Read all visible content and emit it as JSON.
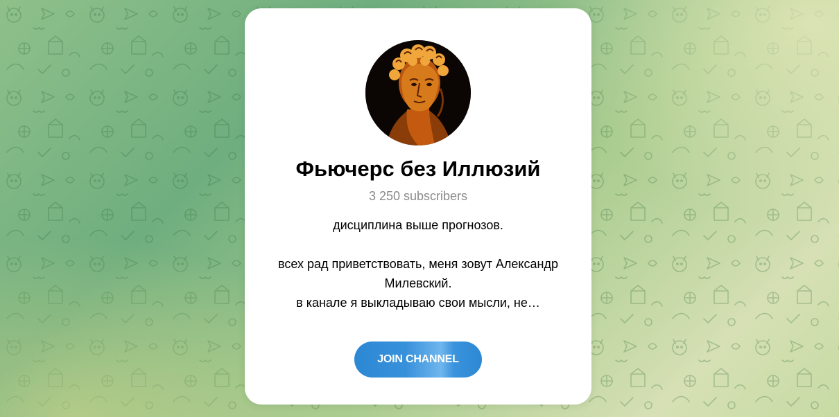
{
  "channel": {
    "title": "Фьючерс без Иллюзий",
    "subscribers": "3 250 subscribers",
    "description_lines": [
      "дисциплина выше прогнозов.",
      "",
      "всех рад приветствовать, меня зовут Александр",
      "Милевский.",
      "в канале я выкладываю свои мысли, не…"
    ],
    "avatar_icon": "david-statue-avatar"
  },
  "actions": {
    "join_label": "JOIN CHANNEL"
  },
  "colors": {
    "button": "#2d88d3",
    "subscribers_text": "#8a8a8a",
    "background_green": "#6fae7f"
  }
}
